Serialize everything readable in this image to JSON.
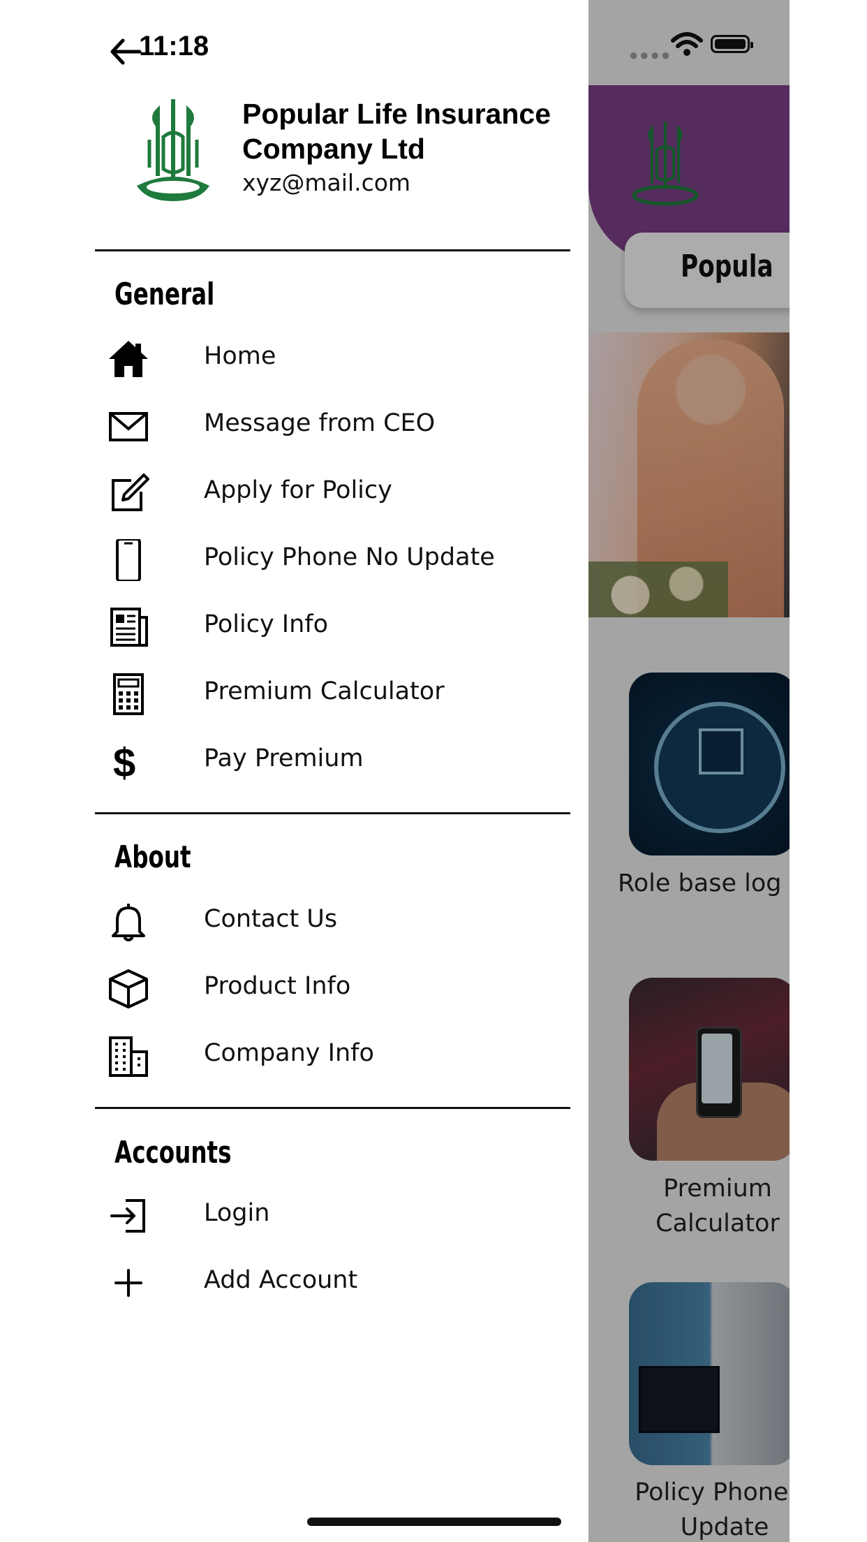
{
  "status_bar": {
    "time": "11:18"
  },
  "profile": {
    "company_name": "Popular Life Insurance Company Ltd",
    "email": "xyz@mail.com",
    "logo_color": "#1f7a3d"
  },
  "sections": {
    "general": {
      "title": "General",
      "items": [
        {
          "label": "Home",
          "icon": "home-icon"
        },
        {
          "label": "Message from CEO",
          "icon": "mail-icon"
        },
        {
          "label": "Apply for Policy",
          "icon": "edit-icon"
        },
        {
          "label": "Policy Phone No Update",
          "icon": "smartphone-icon"
        },
        {
          "label": "Policy Info",
          "icon": "newspaper-icon"
        },
        {
          "label": "Premium Calculator",
          "icon": "calculator-icon"
        },
        {
          "label": "Pay Premium",
          "icon": "dollar-icon"
        }
      ]
    },
    "about": {
      "title": "About",
      "items": [
        {
          "label": "Contact Us",
          "icon": "bell-icon"
        },
        {
          "label": "Product Info",
          "icon": "box-icon"
        },
        {
          "label": "Company Info",
          "icon": "building-icon"
        }
      ]
    },
    "accounts": {
      "title": "Accounts",
      "items": [
        {
          "label": "Login",
          "icon": "login-icon"
        },
        {
          "label": "Add Account",
          "icon": "plus-icon"
        }
      ]
    }
  },
  "background_app": {
    "header_color": "#7b3f88",
    "title_partial": "Popula",
    "cards": [
      {
        "caption": "Role base log"
      },
      {
        "caption": "Premium Calculator"
      },
      {
        "caption": "Policy Phone N Update"
      }
    ]
  }
}
